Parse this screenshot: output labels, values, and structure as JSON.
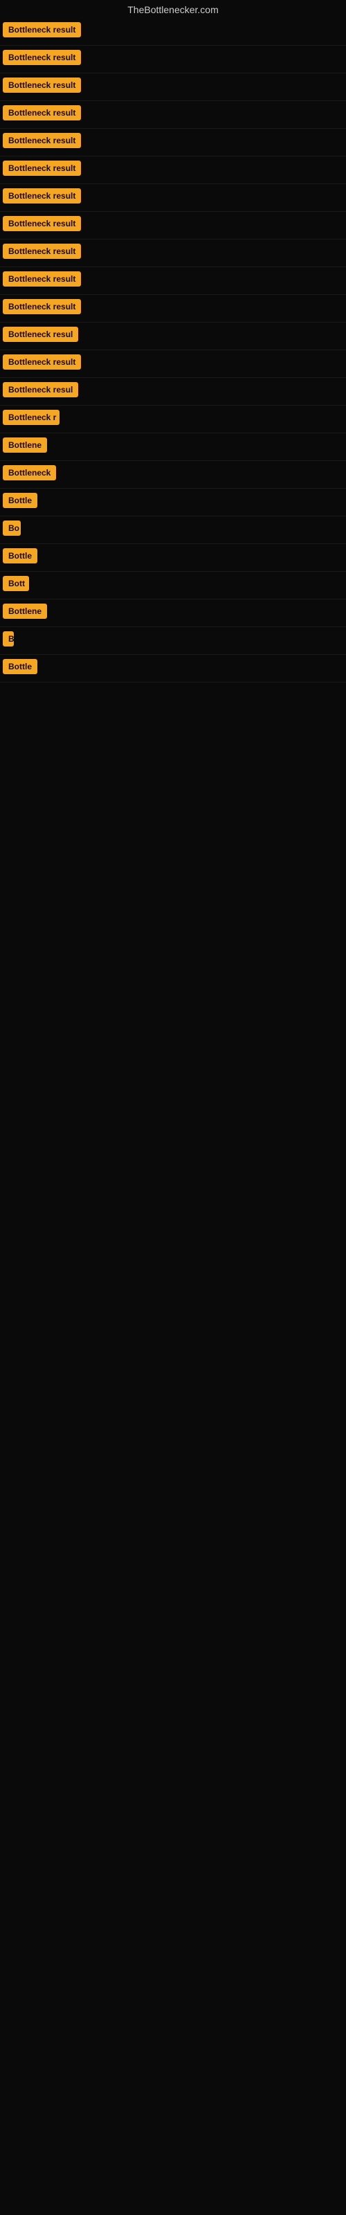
{
  "site": {
    "title": "TheBottlenecker.com"
  },
  "results": [
    {
      "label": "Bottleneck result",
      "width": 130
    },
    {
      "label": "Bottleneck result",
      "width": 130
    },
    {
      "label": "Bottleneck result",
      "width": 130
    },
    {
      "label": "Bottleneck result",
      "width": 130
    },
    {
      "label": "Bottleneck result",
      "width": 130
    },
    {
      "label": "Bottleneck result",
      "width": 130
    },
    {
      "label": "Bottleneck result",
      "width": 130
    },
    {
      "label": "Bottleneck result",
      "width": 130
    },
    {
      "label": "Bottleneck result",
      "width": 130
    },
    {
      "label": "Bottleneck result",
      "width": 130
    },
    {
      "label": "Bottleneck result",
      "width": 130
    },
    {
      "label": "Bottleneck resul",
      "width": 118
    },
    {
      "label": "Bottleneck result",
      "width": 130
    },
    {
      "label": "Bottleneck resul",
      "width": 118
    },
    {
      "label": "Bottleneck r",
      "width": 82
    },
    {
      "label": "Bottlene",
      "width": 66
    },
    {
      "label": "Bottleneck",
      "width": 78
    },
    {
      "label": "Bottle",
      "width": 52
    },
    {
      "label": "Bo",
      "width": 26
    },
    {
      "label": "Bottle",
      "width": 52
    },
    {
      "label": "Bott",
      "width": 38
    },
    {
      "label": "Bottlene",
      "width": 66
    },
    {
      "label": "B",
      "width": 16
    },
    {
      "label": "Bottle",
      "width": 52
    }
  ]
}
